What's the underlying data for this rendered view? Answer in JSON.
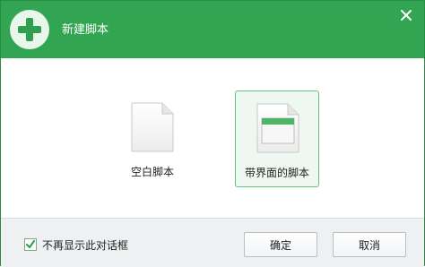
{
  "window": {
    "title": "新建脚本"
  },
  "options": [
    {
      "label": "空白脚本",
      "selected": false,
      "icon": "blank-document-icon"
    },
    {
      "label": "带界面的脚本",
      "selected": true,
      "icon": "ui-document-icon"
    }
  ],
  "footer": {
    "checkbox_label": "不再显示此对话框",
    "checkbox_checked": true,
    "ok_label": "确定",
    "cancel_label": "取消"
  },
  "colors": {
    "accent": "#31a552",
    "selected_border": "#67c17e",
    "selected_bg": "#eef8f0"
  }
}
